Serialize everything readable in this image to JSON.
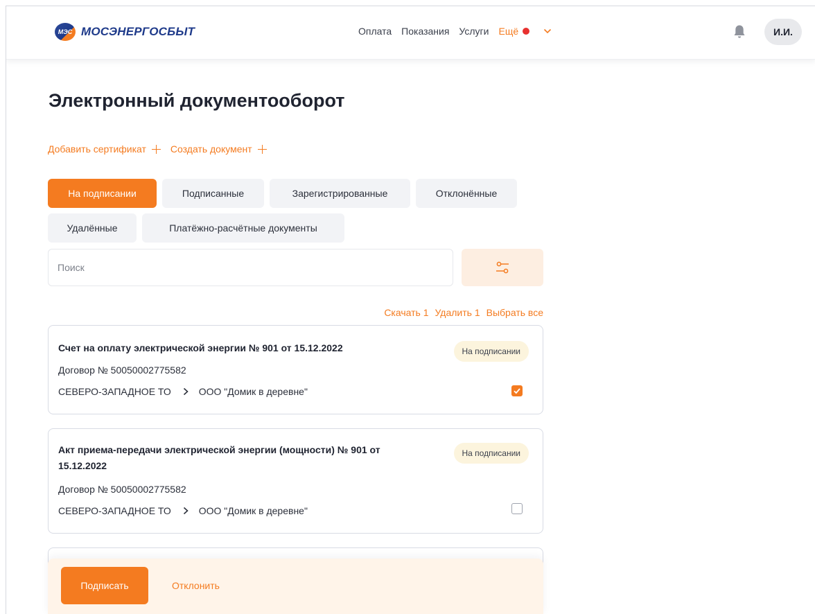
{
  "header": {
    "logo_badge": "МЭС",
    "logo_text": "МОСЭНЕРГОСБЫТ",
    "nav": [
      "Оплата",
      "Показания",
      "Услуги"
    ],
    "more_label": "Ещё",
    "avatar": "И.И."
  },
  "page": {
    "title": "Электронный документооборот",
    "actions": {
      "add_certificate": "Добавить сертификат",
      "create_document": "Создать документ"
    },
    "tabs": [
      "На подписании",
      "Подписанные",
      "Зарегистрированные",
      "Отклонённые",
      "Удалённые",
      "Платёжно-расчётные документы"
    ],
    "active_tab": "На подписании",
    "search": {
      "placeholder": "Поиск"
    },
    "bulk_actions": {
      "download": "Скачать 1",
      "delete": "Удалить 1",
      "select_all": "Выбрать все"
    }
  },
  "documents": [
    {
      "title": "Счет на оплату электрической энергии № 901 от 15.12.2022",
      "contract": "Договор № 50050002775582",
      "from": "СЕВЕРО-ЗАПАДНОЕ ТО",
      "to": "ООО \"Домик в деревне\"",
      "status": "На подписании",
      "checked": true
    },
    {
      "title": "Акт приема-передачи электрической энергии (мощности) № 901 от 15.12.2022",
      "contract": "Договор № 50050002775582",
      "from": "СЕВЕРО-ЗАПАДНОЕ ТО",
      "to": "ООО \"Домик в деревне\"",
      "status": "На подписании",
      "checked": false
    }
  ],
  "bottom_bar": {
    "sign": "Подписать",
    "reject": "Отклонить"
  },
  "colors": {
    "accent": "#f47b20",
    "brand": "#1e3a8a",
    "notification": "#e8312f",
    "badge_bg": "#fcf4dd"
  },
  "icons": {
    "bell": "bell-icon",
    "filter": "filter-sliders-icon",
    "chevron": "chevron-down-icon",
    "route": "chevron-right-icon"
  }
}
